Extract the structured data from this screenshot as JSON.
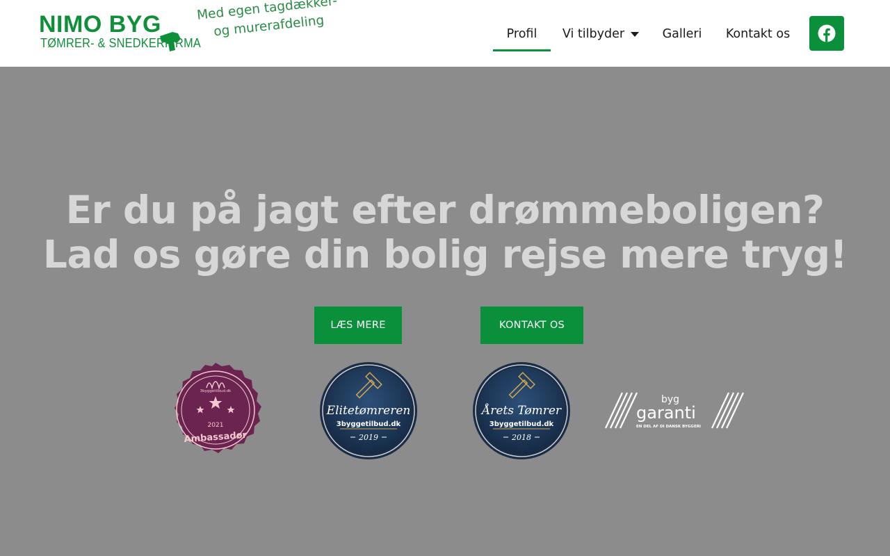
{
  "header": {
    "logo": {
      "brand": "NIMO BYG",
      "subtitle": "TØMRER- & SNEDKERFIRMA",
      "tagline_line1": "Med egen tagdækker-",
      "tagline_line2": "og murerafdeling"
    },
    "nav": [
      {
        "label": "Profil",
        "active": true
      },
      {
        "label": "Vi tilbyder",
        "has_dropdown": true
      },
      {
        "label": "Galleri"
      },
      {
        "label": "Kontakt os"
      }
    ],
    "social_icon": "facebook-icon"
  },
  "hero": {
    "title_line1": "Er du på jagt efter drømmeboligen?",
    "title_line2": "Lad os gøre din bolig rejse mere tryg!",
    "buttons": {
      "read_more": "LÆS MERE",
      "contact": "KONTAKT OS"
    },
    "badges": {
      "ambassador": {
        "site": "3byggetilbud.dk",
        "year": "2021",
        "label": "Ambassadør"
      },
      "elite": {
        "label": "Elitetømreren",
        "site": "3byggetilbud.dk",
        "year": "2019"
      },
      "year_carpenter": {
        "label": "Årets Tømrer",
        "site": "3byggetilbud.dk",
        "year": "2018"
      },
      "garanti": {
        "top": "byg",
        "main": "garanti",
        "sub": "EN DEL AF DI DANSK BYGGERI"
      }
    }
  },
  "colors": {
    "brand_green": "#0f8f3a",
    "button_green": "#0a8f3a",
    "hero_overlay": "#8c8c8c",
    "hero_text": "#d7d7d7",
    "ambassador_purple": "#6b2450",
    "badge_navy": "#1c3553"
  }
}
